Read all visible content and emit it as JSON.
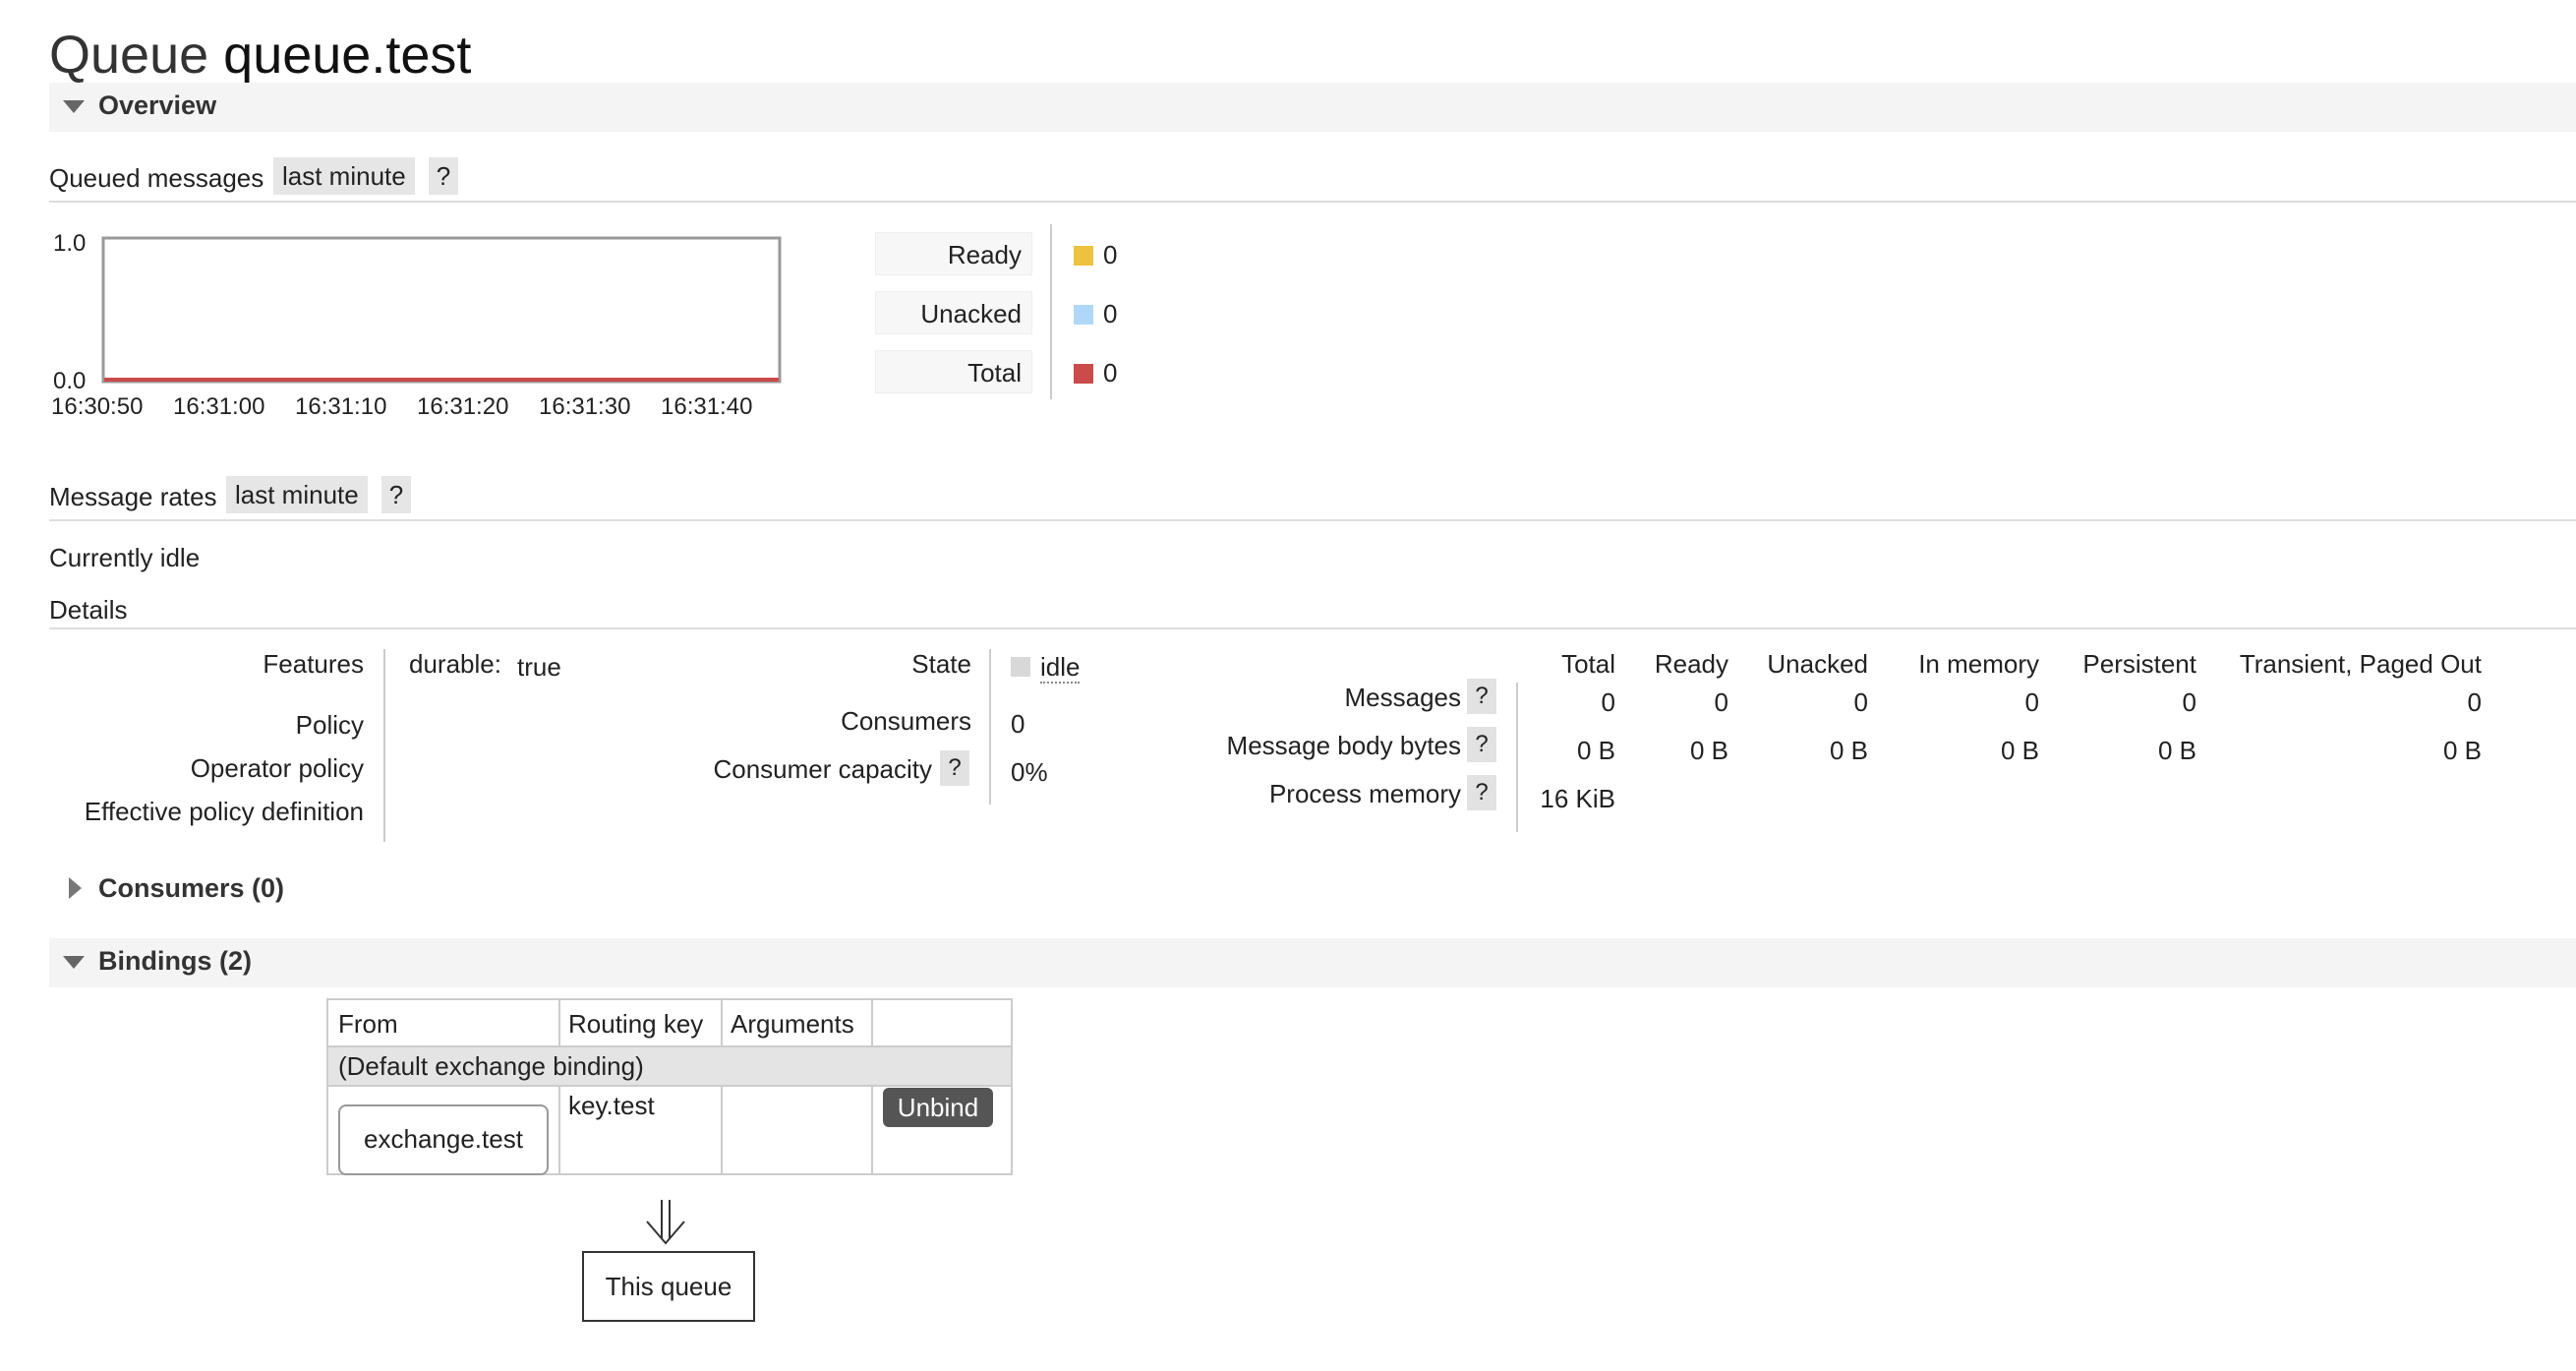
{
  "page": {
    "prefix": "Queue",
    "name": "queue.test"
  },
  "overview": {
    "label": "Overview"
  },
  "queued": {
    "label": "Queued messages",
    "range": "last minute",
    "help": "?",
    "chart": {
      "y_max_label": "1.0",
      "y_min_label": "0.0",
      "x_ticks": [
        "16:30:50",
        "16:31:00",
        "16:31:10",
        "16:31:20",
        "16:31:30",
        "16:31:40"
      ]
    },
    "legend": [
      {
        "label": "Ready",
        "value": "0",
        "color": "#edc240"
      },
      {
        "label": "Unacked",
        "value": "0",
        "color": "#afd8f8"
      },
      {
        "label": "Total",
        "value": "0",
        "color": "#cb4b4b"
      }
    ]
  },
  "rates": {
    "label": "Message rates",
    "range": "last minute",
    "help": "?"
  },
  "idle_text": "Currently idle",
  "details_label": "Details",
  "details": {
    "features_label": "Features",
    "features_key": "durable:",
    "features_value": "true",
    "policy_label": "Policy",
    "operator_policy_label": "Operator policy",
    "effective_policy_label": "Effective policy definition",
    "state_label": "State",
    "state_value": "idle",
    "consumers_label": "Consumers",
    "consumers_value": "0",
    "consumer_capacity_label": "Consumer capacity",
    "consumer_capacity_value": "0%",
    "help": "?"
  },
  "stats": {
    "headers": [
      "Total",
      "Ready",
      "Unacked",
      "In memory",
      "Persistent",
      "Transient, Paged Out"
    ],
    "messages": {
      "label": "Messages",
      "values": [
        "0",
        "0",
        "0",
        "0",
        "0",
        "0"
      ]
    },
    "body_bytes": {
      "label": "Message body bytes",
      "values": [
        "0 B",
        "0 B",
        "0 B",
        "0 B",
        "0 B",
        "0 B"
      ]
    },
    "process_memory": {
      "label": "Process memory",
      "value": "16 KiB"
    }
  },
  "consumers_section": {
    "label": "Consumers (0)"
  },
  "bindings_section": {
    "label": "Bindings (2)"
  },
  "bindings": {
    "headers": [
      "From",
      "Routing key",
      "Arguments"
    ],
    "default_row": "(Default exchange binding)",
    "row": {
      "from": "exchange.test",
      "routing_key": "key.test",
      "action": "Unbind"
    }
  },
  "this_queue": "This queue"
}
